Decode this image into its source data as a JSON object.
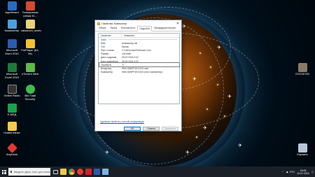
{
  "desktop_left": [
    {
      "label": "AppWizard",
      "color": "#2a6cc2"
    },
    {
      "label": "Телефонная схема 31...",
      "color": "#d34b2f"
    },
    {
      "label": "Компьютер",
      "color": "#4f9ed8"
    },
    {
      "label": "zakazcen_shsfo",
      "color": "#e9d27a"
    },
    {
      "label": "Microsoft Word 2010",
      "color": "#2c5ba8"
    },
    {
      "label": "PotPlayer (64-bit)",
      "color": "#f2c230"
    },
    {
      "label": "Microsoft Excel 2010",
      "color": "#1f7a3a"
    },
    {
      "label": "uTorrent Web",
      "color": "#5fb84a"
    },
    {
      "label": "Online Radio",
      "color": "#333333"
    },
    {
      "label": "360 Total Security",
      "color": "#3fbb4e"
    },
    {
      "label": "E-МЕД",
      "color": "#1aa14d"
    },
    {
      "label": "Новая папка",
      "color": "#f3c94a"
    },
    {
      "label": "AnyDesk",
      "color": "#e23a32"
    }
  ],
  "desktop_right": [
    {
      "label": "DSC00783",
      "color": "#8a7a66"
    },
    {
      "label": "Корзина",
      "color": "#b5c7d8"
    }
  ],
  "dialog": {
    "title": "Свойства: Компьютер",
    "close": "✕",
    "tabs": [
      "Общие",
      "Ярлык",
      "Безопасность",
      "Подробно",
      "Предыдущие версии"
    ],
    "active_tab": "Подробно",
    "col_property": "Свойство",
    "col_value": "Значение",
    "group": "Файл",
    "rows": [
      {
        "k": "Имя",
        "v": "Компьютер.lnk"
      },
      {
        "k": "Тип",
        "v": "Ярлык"
      },
      {
        "k": "Путь к папке",
        "v": "C:\\Users\\user\\Рабочий стол"
      },
      {
        "k": "Размер",
        "v": "443 байт"
      },
      {
        "k": "Дата создания",
        "v": "05.02.2024 0:02"
      },
      {
        "k": "Дата изменения",
        "v": "05.02.2024 0:02"
      },
      {
        "k": "Атрибуты",
        "v": "A"
      },
      {
        "k": "Владелец",
        "v": "WIN-N8NPF4KG41N user"
      },
      {
        "k": "Компьютер",
        "v": "WIN-N8NPF4KG41N (этот компьютер)"
      }
    ],
    "remove_link": "Удаление свойств и личной информации",
    "ok": "OK",
    "cancel": "Отмена",
    "apply": "Применить"
  },
  "taskbar": {
    "search_placeholder": "Введите здесь текст для поиска",
    "apps": [
      {
        "name": "task-view-icon",
        "color": "#cfd6df"
      },
      {
        "name": "explorer-icon",
        "color": "#f3c94a"
      },
      {
        "name": "chrome-icon",
        "color": "#e04a3a"
      },
      {
        "name": "yandex-icon",
        "color": "#e83a2f"
      },
      {
        "name": "media-icon",
        "color": "#d4202a"
      },
      {
        "name": "word-icon",
        "color": "#2c5ba8"
      },
      {
        "name": "window-icon",
        "color": "#7fb3e6"
      }
    ],
    "lang": "РУС",
    "time": "19:25",
    "date": "10.07.2024"
  }
}
